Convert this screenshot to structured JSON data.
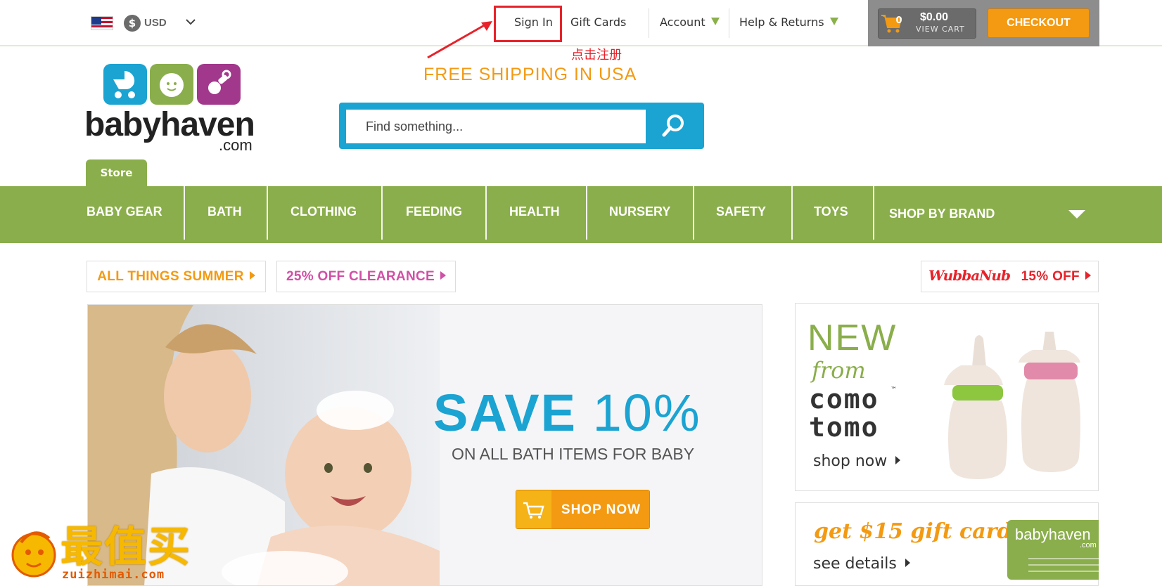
{
  "header": {
    "currency": "USD",
    "links": {
      "sign_in": "Sign In",
      "gift_cards": "Gift Cards",
      "account": "Account",
      "help": "Help & Returns"
    },
    "cart": {
      "count": "0",
      "total": "$0.00",
      "view_label": "VIEW CART"
    },
    "checkout_label": "CHECKOUT"
  },
  "annotation": {
    "note": "点击注册",
    "color": "#e8222a"
  },
  "banner": {
    "free_shipping": "FREE SHIPPING IN USA"
  },
  "logo": {
    "name": "babyhaven",
    "domain": ".com"
  },
  "search": {
    "placeholder": "Find something..."
  },
  "store_tab": "Store",
  "nav": {
    "items": [
      "BABY GEAR",
      "BATH",
      "CLOTHING",
      "FEEDING",
      "HEALTH",
      "NURSERY",
      "SAFETY",
      "TOYS",
      "SHOP BY BRAND"
    ]
  },
  "promos": {
    "summer": "ALL THINGS SUMMER",
    "clearance": "25% OFF CLEARANCE",
    "wubbanub_logo": "WubbaNub",
    "wubbanub_offer": "15% OFF"
  },
  "hero": {
    "save": "SAVE",
    "percent": "10%",
    "subtitle": "ON ALL BATH ITEMS FOR BABY",
    "button": "SHOP NOW"
  },
  "side_cards": {
    "new": {
      "headline": "NEW",
      "from": "from",
      "brand_line1": "como",
      "brand_line2": "tomo",
      "tm": "™",
      "link": "shop now"
    },
    "gift": {
      "headline": "get $15 gift card",
      "link": "see details",
      "card_label": "babyhaven",
      "card_domain": ".com"
    }
  },
  "watermark": {
    "zh": "最值买",
    "en": "zuizhimai.com"
  },
  "colors": {
    "brand_green": "#8aae4b",
    "brand_blue": "#1ba3d2",
    "brand_orange": "#f39a12",
    "pink": "#d14fa6",
    "red": "#e8222a"
  }
}
